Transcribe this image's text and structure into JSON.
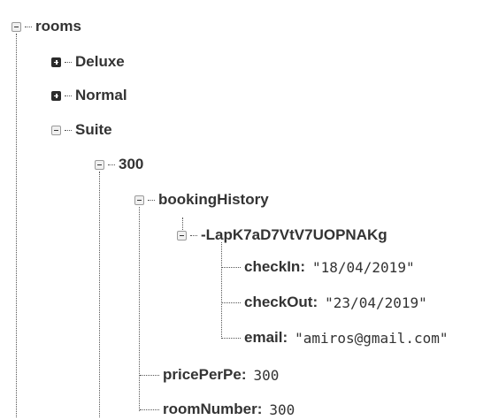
{
  "tree": {
    "root": {
      "key": "rooms",
      "expanded": true
    },
    "deluxe": {
      "key": "Deluxe",
      "expanded": false
    },
    "normal": {
      "key": "Normal",
      "expanded": false
    },
    "suite": {
      "key": "Suite",
      "expanded": true
    },
    "room300": {
      "key": "300",
      "expanded": true
    },
    "bookingHistory": {
      "key": "bookingHistory",
      "expanded": true
    },
    "booking": {
      "key": "-LapK7aD7VtV7UOPNAKg",
      "expanded": true
    },
    "checkIn": {
      "key": "checkIn",
      "value": "\"18/04/2019\""
    },
    "checkOut": {
      "key": "checkOut",
      "value": "\"23/04/2019\""
    },
    "email": {
      "key": "email",
      "value": "\"amiros@gmail.com\""
    },
    "pricePerPe": {
      "key": "pricePerPe",
      "value": "300"
    },
    "roomNumber": {
      "key": "roomNumber",
      "value": "300"
    }
  },
  "punctuation": {
    "colon": ":"
  },
  "icons": {
    "expand": "plus-square-icon",
    "collapse": "minus-square-icon"
  }
}
